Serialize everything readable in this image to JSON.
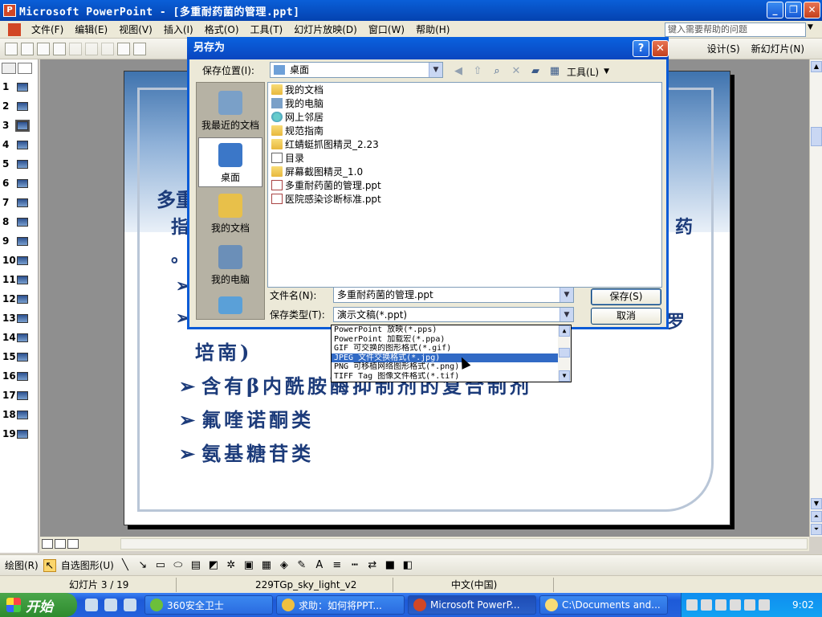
{
  "window": {
    "title": "Microsoft PowerPoint - [多重耐药菌的管理.ppt]"
  },
  "menu": {
    "items": [
      "文件(F)",
      "编辑(E)",
      "视图(V)",
      "插入(I)",
      "格式(O)",
      "工具(T)",
      "幻灯片放映(D)",
      "窗口(W)",
      "帮助(H)"
    ],
    "help_placeholder": "键入需要帮助的问题"
  },
  "toolbar": {
    "design_label": "设计(S)",
    "new_slide_label": "新幻灯片(N)"
  },
  "slides": {
    "numbers": [
      "1",
      "2",
      "3",
      "4",
      "5",
      "6",
      "7",
      "8",
      "9",
      "10",
      "11",
      "12",
      "13",
      "14",
      "15",
      "16",
      "17",
      "18",
      "19"
    ],
    "selected": "3"
  },
  "slide": {
    "line1_left": "多重",
    "line2_left": "指",
    "line2_right": "药",
    "line3_left": "。",
    "row_left_arrow_a": "➢",
    "row_left_arrow_b": "➢",
    "partial_right": "罗",
    "text_a": "培南)",
    "bullet_a": "含有β内酰胺酶抑制剂的复合制剂",
    "bullet_b": "氟喹诺酮类",
    "bullet_c": "氨基糖苷类",
    "bullet_marker": "➢"
  },
  "dialog": {
    "title": "另存为",
    "help_button": "?",
    "close_button": "✕",
    "save_in_label": "保存位置(I):",
    "save_in_value": "桌面",
    "tools_label": "工具(L)",
    "places": [
      {
        "label": "我最近的文档",
        "color": "#7aa0c8"
      },
      {
        "label": "桌面",
        "color": "#3b77c8"
      },
      {
        "label": "我的文档",
        "color": "#e8c04a"
      },
      {
        "label": "我的电脑",
        "color": "#6b8fb8"
      }
    ],
    "files": [
      {
        "name": "我的文档",
        "type": "folder"
      },
      {
        "name": "我的电脑",
        "type": "computer"
      },
      {
        "name": "网上邻居",
        "type": "network"
      },
      {
        "name": "规范指南",
        "type": "folder"
      },
      {
        "name": "红蜻蜓抓图精灵_2.23",
        "type": "folder"
      },
      {
        "name": "目录",
        "type": "shortcut"
      },
      {
        "name": "屏幕截图精灵_1.0",
        "type": "folder"
      },
      {
        "name": "多重耐药菌的管理.ppt",
        "type": "ppt"
      },
      {
        "name": "医院感染诊断标准.ppt",
        "type": "ppt"
      }
    ],
    "filename_label": "文件名(N):",
    "filename_value": "多重耐药菌的管理.ppt",
    "filetype_label": "保存类型(T):",
    "filetype_value": "演示文稿(*.ppt)",
    "save_button": "保存(S)",
    "cancel_button": "取消",
    "type_options": [
      "PowerPoint 放映(*.pps)",
      "PowerPoint 加载宏(*.ppa)",
      "GIF 可交换的图形格式(*.gif)",
      "JPEG 文件交换格式(*.jpg)",
      "PNG 可移植网络图形格式(*.png)",
      "TIFF Tag 图像文件格式(*.tif)"
    ],
    "type_selected_index": 3
  },
  "drawbar": {
    "draw_label": "绘图(R)",
    "autoshapes_label": "自选图形(U)"
  },
  "status": {
    "slide_info": "幻灯片 3 / 19",
    "design": "229TGp_sky_light_v2",
    "language": "中文(中国)"
  },
  "taskbar": {
    "start_label": "开始",
    "tasks": [
      {
        "label": "360安全卫士",
        "color": "#6cbf3a"
      },
      {
        "label": "求助：如何将PPT...",
        "color": "#f0c040"
      },
      {
        "label": "Microsoft PowerP...",
        "color": "#d24726"
      },
      {
        "label": "C:\\Documents and...",
        "color": "#f8dc76"
      }
    ],
    "clock": "9:02"
  }
}
